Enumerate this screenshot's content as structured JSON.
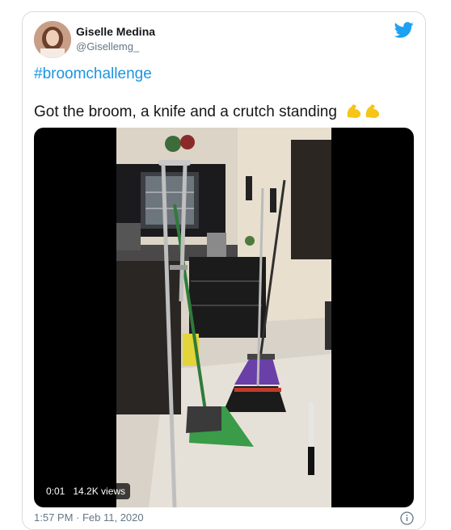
{
  "author": {
    "name": "Giselle Medina",
    "handle": "@Gisellemg_"
  },
  "tweet": {
    "hashtag": "#broomchallenge",
    "text": "Got the broom, a knife and a crutch standing"
  },
  "video": {
    "elapsed": "0:01",
    "views": "14.2K views"
  },
  "footer": {
    "timestamp": "1:57 PM · Feb 11, 2020"
  },
  "icons": {
    "brand": "twitter-bird-icon",
    "emoji": "flexed-biceps-emoji",
    "info": "info-icon"
  },
  "colors": {
    "twitter_blue": "#1da1f2",
    "link": "#1b95e0",
    "text": "#14171a",
    "muted": "#657786"
  }
}
